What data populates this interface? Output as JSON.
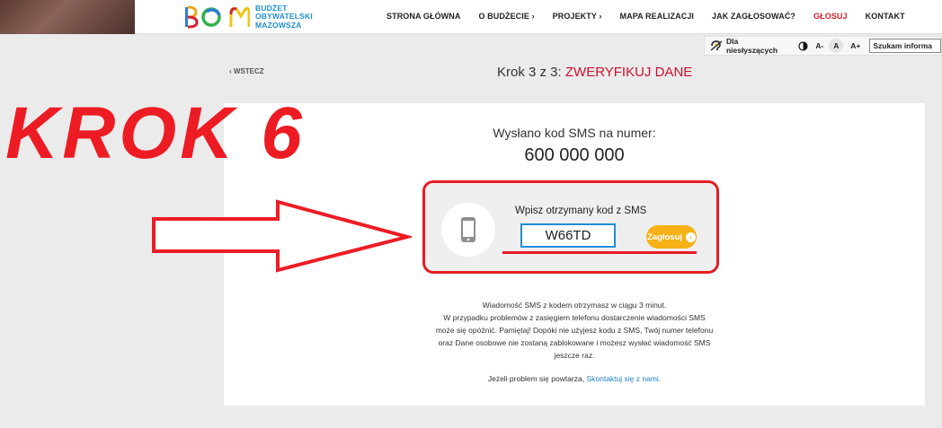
{
  "header": {
    "logo_lines": [
      "BUDŻET",
      "OBYWATELSKI",
      "MAZOWSZA"
    ],
    "nav": [
      "STRONA GŁÓWNA",
      "O BUDŻECIE ›",
      "PROJEKTY ›",
      "MAPA REALIZACJI",
      "JAK ZAGŁOSOWAĆ?",
      "GŁOSUJ",
      "KONTAKT"
    ],
    "active_nav": "GŁOSUJ"
  },
  "a11y": {
    "hearing_label": "Dla niesłyszących",
    "font_minus": "A-",
    "font_normal": "A",
    "font_plus": "A+",
    "search_text": "Szukam informa"
  },
  "back_label": "WSTECZ",
  "step": {
    "prefix": "Krok 3 z 3:",
    "title": "ZWERYFIKUJ DANE"
  },
  "overlay": {
    "krok_text": "KROK 6"
  },
  "card": {
    "sent_label": "Wysłano kod SMS na numer:",
    "phone_number": "600 000 000",
    "sms_prompt": "Wpisz otrzymany kod z SMS",
    "code_value": "W66TD",
    "submit_label": "Zagłosuj",
    "info_lines": [
      "Wiadomość SMS z kodem otrzymasz w ciągu 3 minut.",
      "W przypadku problemów z zasięgiem telefonu dostarczenie wiadomości SMS",
      "może się opóźnić. Pamiętaj! Dopóki nie użyjesz kodu z SMS, Twój numer telefonu",
      "oraz Dane osobowe nie zostaną zablokowane i możesz wysłać wiadomość SMS",
      "jeszcze raz."
    ],
    "trouble_text": "Jeżeli problem się powtarza,",
    "contact_link": "Skontaktuj się z nami."
  },
  "colors": {
    "accent_red": "#c8102e",
    "annotation_red": "#ed1c24",
    "button_yellow": "#f6b116",
    "link_blue": "#1f7fc4"
  }
}
